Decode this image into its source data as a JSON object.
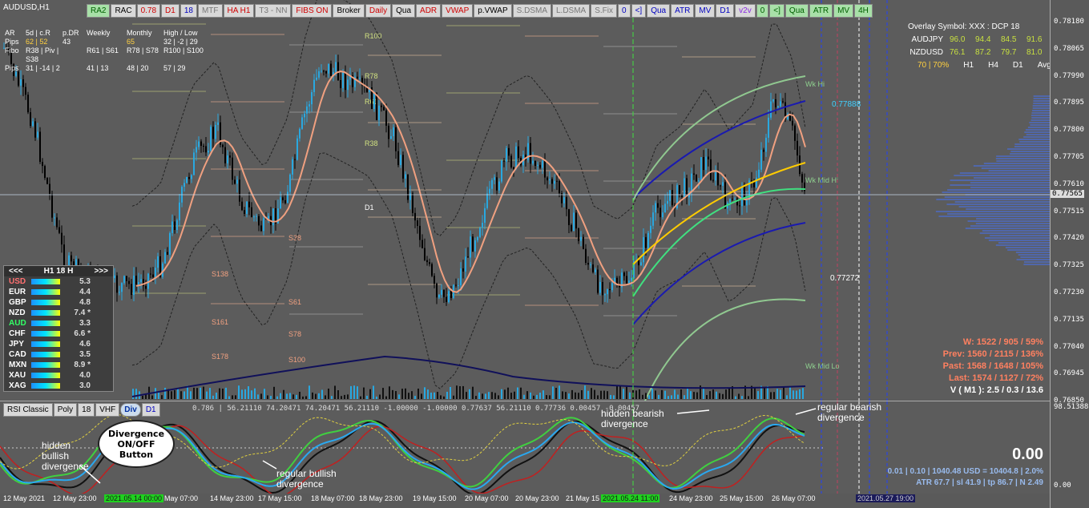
{
  "symbol": "AUDUSD,H1",
  "toolbar": [
    {
      "label": "RA2",
      "style": "green"
    },
    {
      "label": "RAC",
      "style": ""
    },
    {
      "label": "0.78",
      "style": "red"
    },
    {
      "label": "D1",
      "style": "red"
    },
    {
      "label": "18",
      "style": "blue"
    },
    {
      "label": "MTF",
      "style": "grey"
    },
    {
      "label": "HA H1",
      "style": "red"
    },
    {
      "label": "T3 - NN",
      "style": "grey"
    },
    {
      "label": "FIBS ON",
      "style": "red"
    },
    {
      "label": "Broker",
      "style": ""
    },
    {
      "label": "Daily",
      "style": "red"
    },
    {
      "label": "Qua",
      "style": ""
    },
    {
      "label": "ADR",
      "style": "red"
    },
    {
      "label": "VWAP",
      "style": "red"
    },
    {
      "label": "p.VWAP",
      "style": ""
    },
    {
      "label": "S.DSMA",
      "style": "grey"
    },
    {
      "label": "L.DSMA",
      "style": "grey"
    },
    {
      "label": "S.Fix",
      "style": "grey"
    },
    {
      "label": "0",
      "style": "blue"
    },
    {
      "label": "<]",
      "style": "blue"
    },
    {
      "label": "Qua",
      "style": "blue"
    },
    {
      "label": "ATR",
      "style": "blue"
    },
    {
      "label": "MV",
      "style": "blue"
    },
    {
      "label": "D1",
      "style": "blue"
    },
    {
      "label": "v2v",
      "style": "purple"
    },
    {
      "label": "0",
      "style": "green"
    },
    {
      "label": "<]",
      "style": "green"
    },
    {
      "label": "Qua",
      "style": "green"
    },
    {
      "label": "ATR",
      "style": "green"
    },
    {
      "label": "MV",
      "style": "green"
    },
    {
      "label": "4H",
      "style": "green"
    }
  ],
  "stats_block": {
    "rows": [
      [
        "AR",
        "5d | c.R",
        "p.DR",
        "Weekly",
        "Monthly",
        "High / Low"
      ],
      [
        "Pips",
        "62 | 52",
        "43",
        "",
        "65",
        "32 | -2 | 29"
      ],
      [
        "Fibo",
        "R38 | Piv | S38",
        "",
        "R61 | S61",
        "R78 | S78",
        "R100 | S100"
      ],
      [
        "Pips",
        "31 | -14 | 2",
        "",
        "41 | 13",
        "48 | 20",
        "57 | 29"
      ]
    ]
  },
  "strength_meter": {
    "header_left": "<<<",
    "header_mid": "H1  18  H",
    "header_right": ">>>",
    "rows": [
      {
        "cur": "USD",
        "val": "5.3",
        "color": "#ff7070"
      },
      {
        "cur": "EUR",
        "val": "4.4",
        "color": "#ffffff"
      },
      {
        "cur": "GBP",
        "val": "4.8",
        "color": "#ffffff"
      },
      {
        "cur": "NZD",
        "val": "7.4 *",
        "color": "#ffffff"
      },
      {
        "cur": "AUD",
        "val": "3.3",
        "color": "#33ff66"
      },
      {
        "cur": "CHF",
        "val": "6.6 *",
        "color": "#ffffff"
      },
      {
        "cur": "JPY",
        "val": "4.6",
        "color": "#ffffff"
      },
      {
        "cur": "CAD",
        "val": "3.5",
        "color": "#ffffff"
      },
      {
        "cur": "MXN",
        "val": "8.9 *",
        "color": "#ffffff"
      },
      {
        "cur": "XAU",
        "val": "4.0",
        "color": "#ffffff"
      },
      {
        "cur": "XAG",
        "val": "3.0",
        "color": "#ffffff"
      }
    ]
  },
  "overlay_panel": {
    "title": "Overlay Symbol: XXX : DCP 18",
    "rows": [
      {
        "sym": "AUDJPY",
        "vals": [
          "96.0",
          "94.4",
          "84.5",
          "91.6"
        ]
      },
      {
        "sym": "NZDUSD",
        "vals": [
          "76.1",
          "87.2",
          "79.7",
          "81.0"
        ]
      }
    ],
    "footer": [
      "70 | 70%",
      "H1",
      "H4",
      "D1",
      "Avg"
    ]
  },
  "price_ticks": [
    "0.78180",
    "0.78065",
    "0.77990",
    "0.77895",
    "0.77800",
    "0.77705",
    "0.77610",
    "0.77515",
    "0.77420",
    "0.77325",
    "0.77230",
    "0.77135",
    "0.77040",
    "0.76945",
    "0.76850"
  ],
  "price_labels": {
    "current": "0.77565",
    "upper": "0.77888",
    "lower": "0.77272"
  },
  "osc_ticks": {
    "top": "98.51388",
    "bottom": "0.00"
  },
  "levels_labels": [
    "R100",
    "R78",
    "R61",
    "R38",
    "D1",
    "S38",
    "S61",
    "S78",
    "S100",
    "S138",
    "S161",
    "S178",
    "Wk Hi",
    "Wk Mid Hi",
    "Wk Mid Lo"
  ],
  "right_stats": [
    {
      "text": "W: 1522 / 905 / 59%",
      "color": "#ff8060"
    },
    {
      "text": "Prev: 1560 / 2115 / 136%",
      "color": "#ff8060"
    },
    {
      "text": "Past: 1568 / 1648 / 105%",
      "color": "#ff8060"
    },
    {
      "text": "Last: 1574 / 1127 / 72%",
      "color": "#ff8060"
    },
    {
      "text": "V ( M1 ): 2.5 / 0.3 / 13.6",
      "color": "#ffffff"
    }
  ],
  "lower_toolbar": [
    "RSI Classic",
    "Poly",
    "18",
    "VHF",
    "Div",
    "D1"
  ],
  "indicator_values": "0.786 | 56.21110  74.20471  74.20471  56.21110  -1.00000  -1.00000  0.77637  56.21110  0.77736  0.00457  -0.00457",
  "osc_panel": {
    "big_value": "0.00",
    "line1": "0.01  |  0.10  |  1040.48 USD = 10404.8  |  2.0%",
    "line2": "ATR 67.7  |  sl 41.9  |  tp 86.7  |  N 2.49"
  },
  "annotations": {
    "hidden_bullish": "hidden\nbullish\ndivergence",
    "regular_bullish": "regular bullish\ndivergence",
    "hidden_bearish": "hidden bearish\ndivergence",
    "regular_bearish": "regular bearish\ndivergence",
    "bubble": "Divergence\nON/OFF\nButton"
  },
  "time_labels": [
    {
      "text": "12 May 2021",
      "style": ""
    },
    {
      "text": "12 May 23:00",
      "style": ""
    },
    {
      "text": "2021.05.14 00:00",
      "style": "hl"
    },
    {
      "text": "May 07:00",
      "style": ""
    },
    {
      "text": "14 May 23:00",
      "style": ""
    },
    {
      "text": "17 May 15:00",
      "style": ""
    },
    {
      "text": "18 May 07:00",
      "style": ""
    },
    {
      "text": "18 May 23:00",
      "style": ""
    },
    {
      "text": "19 May 15:00",
      "style": ""
    },
    {
      "text": "20 May 07:00",
      "style": ""
    },
    {
      "text": "20 May 23:00",
      "style": ""
    },
    {
      "text": "21 May 15",
      "style": ""
    },
    {
      "text": "2021.05.24 11:00",
      "style": "hl"
    },
    {
      "text": "24 May 23:00",
      "style": ""
    },
    {
      "text": "25 May 15:00",
      "style": ""
    },
    {
      "text": "26 May 07:00",
      "style": ""
    },
    {
      "text": "2021.05.27 19:00",
      "style": "hl2"
    }
  ],
  "colors": {
    "bull": "#29a8e0",
    "bear": "#000000",
    "ma": "#f0a080",
    "band_blue": "#1a1ab0",
    "band_green": "#90c890"
  }
}
